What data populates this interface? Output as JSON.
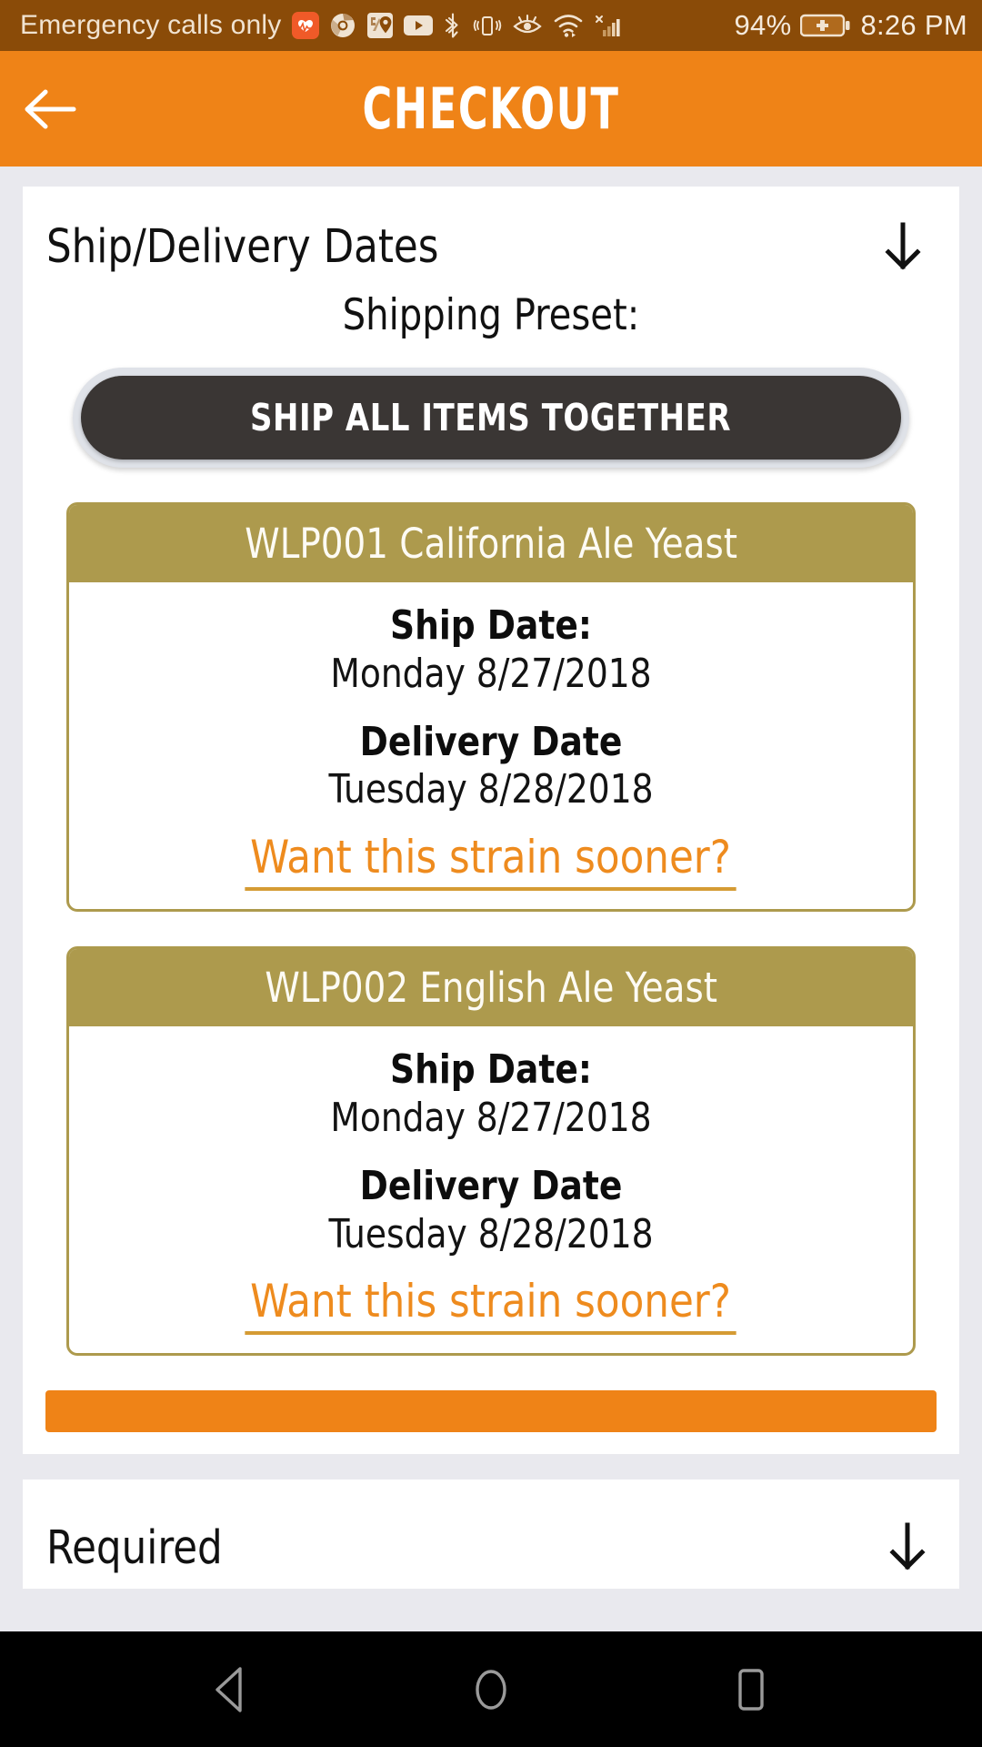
{
  "status_bar": {
    "carrier_text": "Emergency calls only",
    "battery_percent": "94%",
    "clock": "8:26 PM",
    "icons": [
      "heart-health-icon",
      "chrome-icon",
      "google-maps-icon",
      "youtube-icon",
      "bluetooth-icon",
      "vibrate-icon",
      "eye-comfort-icon",
      "wifi-icon",
      "cellular-signal-no-service-icon",
      "battery-charging-icon"
    ],
    "background_color": "#8a4b08"
  },
  "app_bar": {
    "title": "CHECKOUT",
    "back_icon": "arrow-left-icon",
    "background_color": "#ef8317"
  },
  "section": {
    "title": "Ship/Delivery Dates",
    "collapse_icon": "arrow-down-icon",
    "preset_label": "Shipping Preset:",
    "preset_button_label": "SHIP ALL ITEMS TOGETHER",
    "preset_button_color": "#3a3634"
  },
  "strains": [
    {
      "name": "WLP001 California Ale Yeast",
      "ship_date_label": "Ship Date:",
      "ship_date_value": "Monday 8/27/2018",
      "delivery_date_label": "Delivery Date",
      "delivery_date_value": "Tuesday 8/28/2018",
      "sooner_link": "Want this strain sooner?"
    },
    {
      "name": "WLP002 English Ale Yeast",
      "ship_date_label": "Ship Date:",
      "ship_date_value": "Monday 8/27/2018",
      "delivery_date_label": "Delivery Date",
      "delivery_date_value": "Tuesday 8/28/2018",
      "sooner_link": "Want this strain sooner?"
    }
  ],
  "continue_bar": {
    "label": "",
    "color": "#ef8317"
  },
  "next_section": {
    "title": "Required"
  },
  "nav_bar": {
    "back_icon": "triangle-back-icon",
    "home_icon": "circle-home-icon",
    "recents_icon": "square-recents-icon"
  },
  "colors": {
    "accent_orange": "#ef8317",
    "gold": "#ad9a4d",
    "page_background": "#e9e9ee",
    "link_orange": "#ee8b1e"
  }
}
